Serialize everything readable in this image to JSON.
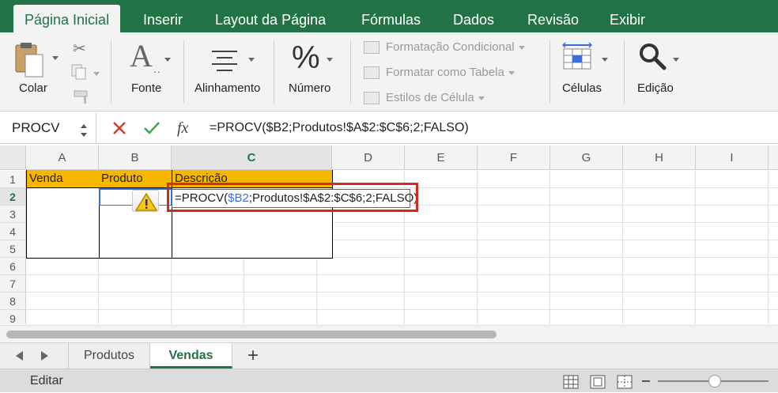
{
  "ribbon_tabs": [
    "Página Inicial",
    "Inserir",
    "Layout da Página",
    "Fórmulas",
    "Dados",
    "Revisão",
    "Exibir"
  ],
  "groups": {
    "colar": "Colar",
    "fonte": "Fonte",
    "alinhamento": "Alinhamento",
    "numero": "Número",
    "celulas": "Células",
    "edicao": "Edição"
  },
  "conditional": [
    "Formatação Condicional",
    "Formatar como Tabela",
    "Estilos de Célula"
  ],
  "namebox": "PROCV",
  "fx": "fx",
  "formula": "=PROCV($B2;Produtos!$A$2:$C$6;2;FALSO)",
  "edit": {
    "prefix": "=PROCV(",
    "ref": "$B2",
    "suffix": ";Produtos!$A$2:$C$6;2;FALSO)"
  },
  "columns": [
    "A",
    "B",
    "C",
    "D",
    "E",
    "F",
    "G",
    "H",
    "I"
  ],
  "rows": [
    "1",
    "2",
    "3",
    "4",
    "5",
    "6",
    "7",
    "8",
    "9"
  ],
  "headers": [
    "Venda",
    "Produto",
    "Descrição"
  ],
  "sheets": [
    "Produtos",
    "Vendas"
  ],
  "add_sheet": "+",
  "status": "Editar",
  "colors": {
    "accent": "#217346",
    "header_fill": "#f7b600",
    "highlight": "#d22b1f",
    "ref_blue": "#3b6fd8"
  }
}
